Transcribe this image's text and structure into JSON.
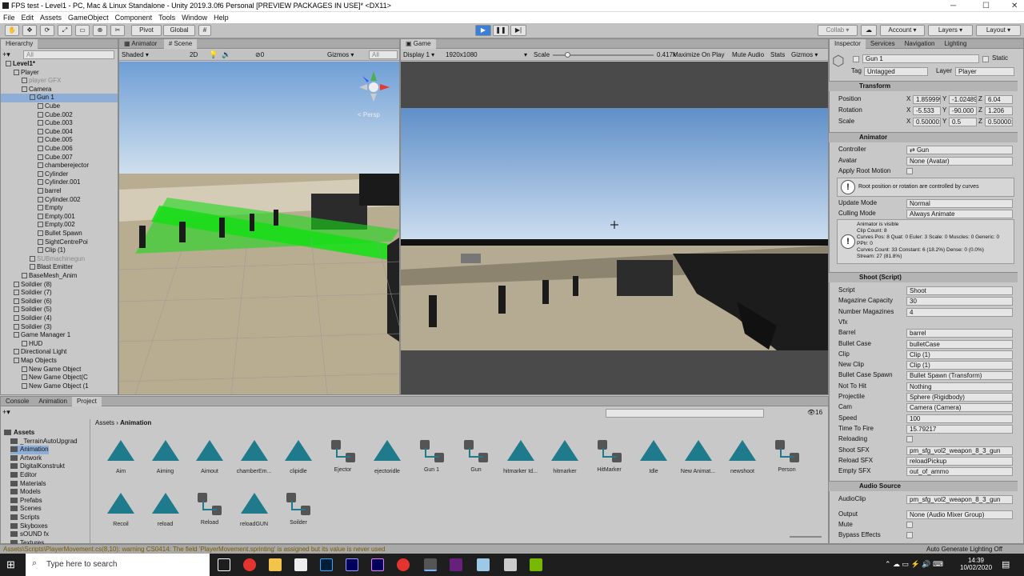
{
  "window": {
    "title": "FPS test - Level1 - PC, Mac & Linux Standalone - Unity 2019.3.0f6 Personal [PREVIEW PACKAGES IN USE]* <DX11>",
    "min": "─",
    "max": "☐",
    "close": "✕"
  },
  "menu": [
    "File",
    "Edit",
    "Assets",
    "GameObject",
    "Component",
    "Tools",
    "Window",
    "Help"
  ],
  "toolbar": {
    "pivot": "Pivot",
    "global": "Global",
    "collab": "Collab ▾",
    "account": "Account",
    "layers": "Layers",
    "layout": "Layout"
  },
  "hierarchy": {
    "tab": "Hierarchy",
    "search": "All",
    "items": [
      {
        "label": "Level1*",
        "indent": 0,
        "bold": true
      },
      {
        "label": "Player",
        "indent": 1
      },
      {
        "label": "player GFX",
        "indent": 2,
        "grey": true
      },
      {
        "label": "Camera",
        "indent": 2
      },
      {
        "label": "Gun 1",
        "indent": 3,
        "sel": true
      },
      {
        "label": "Cube",
        "indent": 4
      },
      {
        "label": "Cube.002",
        "indent": 4
      },
      {
        "label": "Cube.003",
        "indent": 4
      },
      {
        "label": "Cube.004",
        "indent": 4
      },
      {
        "label": "Cube.005",
        "indent": 4
      },
      {
        "label": "Cube.006",
        "indent": 4
      },
      {
        "label": "Cube.007",
        "indent": 4
      },
      {
        "label": "chamberejector",
        "indent": 4
      },
      {
        "label": "Cylinder",
        "indent": 4
      },
      {
        "label": "Cylinder.001",
        "indent": 4
      },
      {
        "label": "barrel",
        "indent": 4
      },
      {
        "label": "Cylinder.002",
        "indent": 4
      },
      {
        "label": "Empty",
        "indent": 4
      },
      {
        "label": "Empty.001",
        "indent": 4
      },
      {
        "label": "Empty.002",
        "indent": 4
      },
      {
        "label": "Bullet Spawn",
        "indent": 4
      },
      {
        "label": "SightCentrePoi",
        "indent": 4
      },
      {
        "label": "Clip (1)",
        "indent": 4
      },
      {
        "label": "SUBmachinegun",
        "indent": 3,
        "grey": true
      },
      {
        "label": "Blast Emitter",
        "indent": 3
      },
      {
        "label": "BaseMesh_Anim",
        "indent": 2
      },
      {
        "label": "Soildier (8)",
        "indent": 1
      },
      {
        "label": "Soildier (7)",
        "indent": 1
      },
      {
        "label": "Soildier (6)",
        "indent": 1
      },
      {
        "label": "Soildier (5)",
        "indent": 1
      },
      {
        "label": "Soildier (4)",
        "indent": 1
      },
      {
        "label": "Soildier (3)",
        "indent": 1
      },
      {
        "label": "Game Manager 1",
        "indent": 1
      },
      {
        "label": "HUD",
        "indent": 2
      },
      {
        "label": "Directional Light",
        "indent": 1
      },
      {
        "label": "Map Objects",
        "indent": 1
      },
      {
        "label": "New Game Object",
        "indent": 2
      },
      {
        "label": "New Game Object(C",
        "indent": 2
      },
      {
        "label": "New Game Object (1",
        "indent": 2
      }
    ]
  },
  "scene": {
    "tabs": [
      "Animator",
      "Scene"
    ],
    "shading": "Shaded",
    "mode": "2D",
    "gizmos": "Gizmos",
    "search": "All",
    "fx": "0",
    "persp": "< Persp"
  },
  "game": {
    "tab": "Game",
    "display": "Display 1",
    "resolution": "1920x1080",
    "scale_label": "Scale",
    "scale_value": "0.417x",
    "scale_fraction": 0.12,
    "maximize": "Maximize On Play",
    "mute": "Mute Audio",
    "stats": "Stats",
    "gizmos": "Gizmos"
  },
  "inspector": {
    "tabs": [
      "Inspector",
      "Services",
      "Navigation",
      "Lighting"
    ],
    "object_name": "Gun 1",
    "static": "Static",
    "tag_label": "Tag",
    "tag": "Untagged",
    "layer_label": "Layer",
    "layer": "Player",
    "transform": {
      "title": "Transform",
      "rows": [
        {
          "label": "Position",
          "x": "1.859999",
          "y": "-1.02489",
          "z": "6.04"
        },
        {
          "label": "Rotation",
          "x": "-5.533",
          "y": "-90.000",
          "z": "1.206"
        },
        {
          "label": "Scale",
          "x": "0.500001",
          "y": "0.5",
          "z": "0.500001"
        }
      ]
    },
    "animator": {
      "title": "Animator",
      "controller_label": "Controller",
      "controller": "Gun",
      "avatar_label": "Avatar",
      "avatar": "None (Avatar)",
      "root_label": "Apply Root Motion",
      "root_note": "Root position or rotation are controlled by curves",
      "update_label": "Update Mode",
      "update": "Normal",
      "culling_label": "Culling Mode",
      "culling": "Always Animate",
      "info": [
        "Animator is visible",
        "Clip Count: 8",
        "Curves Pos: 8 Quat: 0 Euler: 3 Scale: 0 Muscles: 0 Generic: 0",
        "PPtr: 0",
        "Curves Count: 33 Constant: 6 (18.2%) Dense: 0 (0.0%)",
        "Stream: 27 (81.8%)"
      ]
    },
    "shoot": {
      "title": "Shoot (Script)",
      "rows": [
        {
          "label": "Script",
          "value": "Shoot",
          "grey": true
        },
        {
          "label": "Magazine Capacity",
          "value": "30"
        },
        {
          "label": "Number Magazines",
          "value": "4"
        },
        {
          "label": "Vfx",
          "value": ""
        },
        {
          "label": "Barrel",
          "value": "barrel"
        },
        {
          "label": "Bullet Case",
          "value": "bulletCase"
        },
        {
          "label": "Clip",
          "value": "Clip (1)"
        },
        {
          "label": "New Clip",
          "value": "Clip (1)"
        },
        {
          "label": "Bullet Case Spawn",
          "value": "Bullet Spawn (Transform)"
        },
        {
          "label": "Not To Hit",
          "value": "Nothing"
        },
        {
          "label": "Projectile",
          "value": "Sphere (Rigidbody)"
        },
        {
          "label": "Cam",
          "value": "Camera (Camera)"
        },
        {
          "label": "Speed",
          "value": "100"
        },
        {
          "label": "Time To Fire",
          "value": "15.79217"
        },
        {
          "label": "Reloading",
          "value": ""
        },
        {
          "label": "Shoot SFX",
          "value": "pm_sfg_vol2_weapon_8_3_gun"
        },
        {
          "label": "Reload SFX",
          "value": "reloadPickup"
        },
        {
          "label": "Empty SFX",
          "value": "out_of_ammo"
        }
      ]
    },
    "audio": {
      "title": "Audio Source",
      "rows": [
        {
          "label": "AudioClip",
          "value": "pm_sfg_vol2_weapon_8_3_gun"
        },
        {
          "label": "Output",
          "value": "None (Audio Mixer Group)"
        },
        {
          "label": "Mute",
          "value": ""
        },
        {
          "label": "Bypass Effects",
          "value": ""
        }
      ]
    }
  },
  "project": {
    "tabs": [
      "Console",
      "Animation",
      "Project"
    ],
    "breadcrumb_root": "Assets",
    "breadcrumb_leaf": "Animation",
    "count": "16",
    "folders": [
      "Assets",
      "_TerrainAutoUpgrad",
      "Animation",
      "Artwork",
      "DigitalKonstrukt",
      "Editor",
      "Materials",
      "Models",
      "Prefabs",
      "Scenes",
      "Scripts",
      "Skyboxes",
      "sOUND fx",
      "Textures"
    ],
    "assets": [
      {
        "name": "Aim",
        "kind": "clip"
      },
      {
        "name": "Aiming",
        "kind": "clip"
      },
      {
        "name": "Aimout",
        "kind": "clip"
      },
      {
        "name": "chamberEm...",
        "kind": "clip"
      },
      {
        "name": "clipidle",
        "kind": "clip"
      },
      {
        "name": "Ejector",
        "kind": "ctrl"
      },
      {
        "name": "ejectoridle",
        "kind": "clip"
      },
      {
        "name": "Gun 1",
        "kind": "ctrl"
      },
      {
        "name": "Gun",
        "kind": "ctrl"
      },
      {
        "name": "hitmarker Id...",
        "kind": "clip"
      },
      {
        "name": "hitmarker",
        "kind": "clip"
      },
      {
        "name": "HitMarker",
        "kind": "ctrl"
      },
      {
        "name": "Idle",
        "kind": "clip"
      },
      {
        "name": "New Animat...",
        "kind": "clip"
      },
      {
        "name": "newshoot",
        "kind": "clip"
      },
      {
        "name": "Person",
        "kind": "ctrl"
      },
      {
        "name": "Recoil",
        "kind": "clip"
      },
      {
        "name": "reload",
        "kind": "clip"
      },
      {
        "name": "Reload",
        "kind": "ctrl"
      },
      {
        "name": "reloadGUN",
        "kind": "clip"
      },
      {
        "name": "Soilder",
        "kind": "ctrl"
      }
    ]
  },
  "status": {
    "message": "Assets\\Scripts\\PlayerMovement.cs(8,10): warning CS0414: The field 'PlayerMovement.sprinting' is assigned but its value is never used",
    "right": "Auto Generate Lighting Off"
  },
  "taskbar": {
    "search": "Type here to search",
    "time": "14:39",
    "date": "10/02/2020"
  }
}
